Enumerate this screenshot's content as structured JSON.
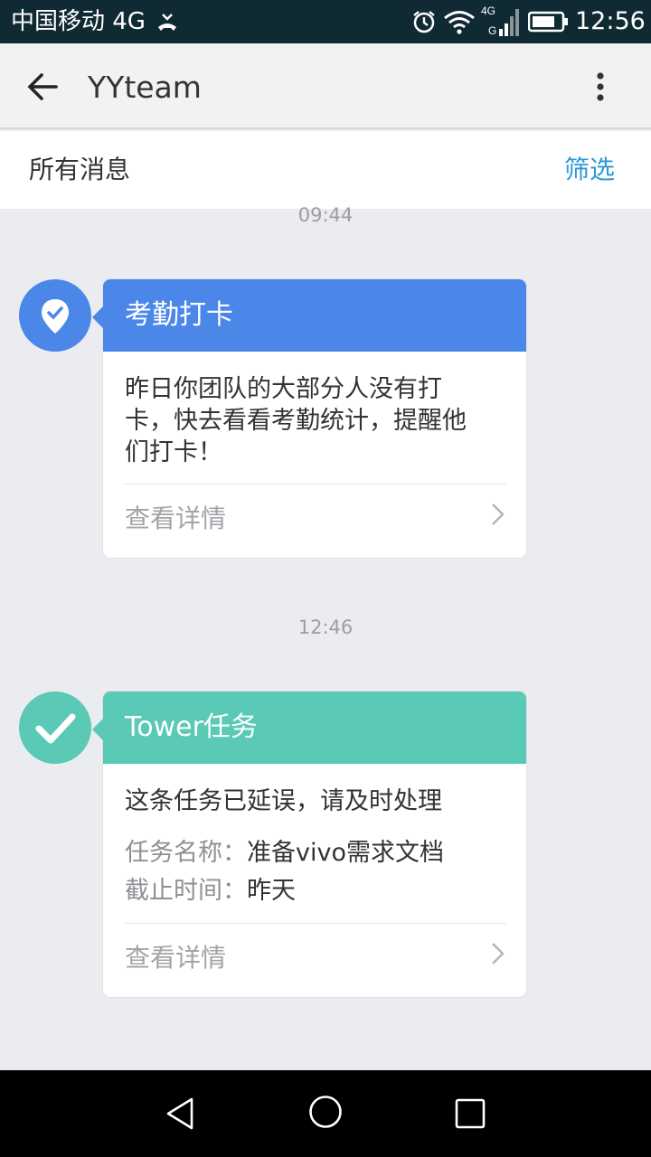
{
  "status_bar": {
    "carrier": "中国移动 4G",
    "network": "4G",
    "time": "12:56",
    "icons": [
      "call-end-icon",
      "alarm-icon",
      "wifi-icon",
      "signal-icon",
      "battery-icon"
    ]
  },
  "app_bar": {
    "title": "YYteam",
    "back_icon": "arrow-left-icon",
    "menu_icon": "more-vertical-icon"
  },
  "filter_bar": {
    "title": "所有消息",
    "filter_label": "筛选"
  },
  "messages": [
    {
      "time": "09:44",
      "icon": "location-check-icon",
      "header": "考勤打卡",
      "body_line1": "昨日你团队的大部分人没有打",
      "body_line2": "卡，快去看看考勤统计，提醒他",
      "body_line3": "们打卡！",
      "link": "查看详情"
    },
    {
      "time": "12:46",
      "icon": "checkmark-icon",
      "header": "Tower任务",
      "body": "这条任务已延误，请及时处理",
      "task_label": "任务名称：",
      "task_value": "准备vivo需求文档",
      "due_label": "截止时间：",
      "due_value": "昨天",
      "link": "查看详情"
    }
  ],
  "colors": {
    "attendance": "#4b87e8",
    "tower": "#5ac9b5",
    "filter_link": "#2c9ad9",
    "status_bar": "#102a33"
  },
  "nav_bar": {
    "icons": [
      "back-triangle-icon",
      "home-circle-icon",
      "recents-square-icon"
    ]
  }
}
